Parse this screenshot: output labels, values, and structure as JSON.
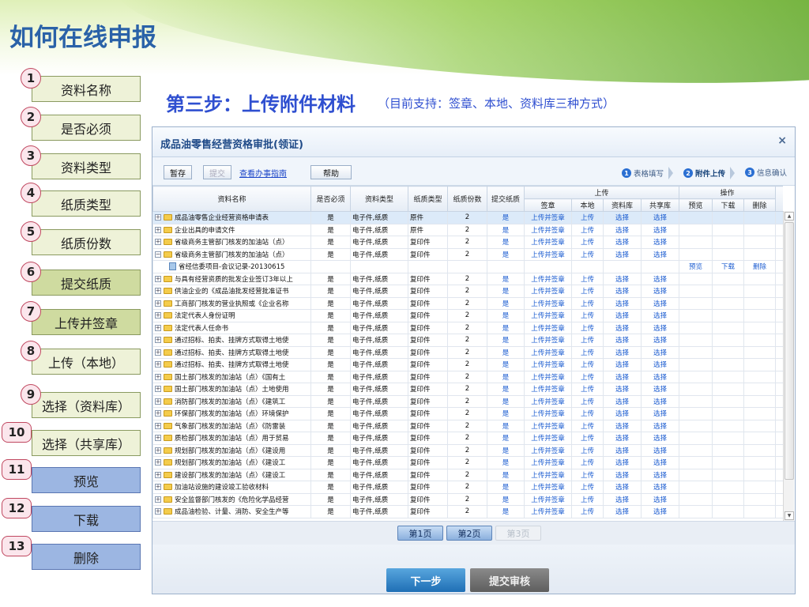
{
  "slide": {
    "title": "如何在线申报",
    "subtitle": "第三步：上传附件材料",
    "subnote": "（目前支持：签章、本地、资料库三种方式）"
  },
  "steps": [
    {
      "num": "1",
      "label": "资料名称"
    },
    {
      "num": "2",
      "label": "是否必须"
    },
    {
      "num": "3",
      "label": "资料类型"
    },
    {
      "num": "4",
      "label": "纸质类型"
    },
    {
      "num": "5",
      "label": "纸质份数"
    },
    {
      "num": "6",
      "label": "提交纸质"
    },
    {
      "num": "7",
      "label": "上传并签章"
    },
    {
      "num": "8",
      "label": "上传（本地）"
    },
    {
      "num": "9",
      "label": "选择（资料库）"
    },
    {
      "num": "10",
      "label": "选择（共享库）"
    },
    {
      "num": "11",
      "label": "预览"
    },
    {
      "num": "12",
      "label": "下载"
    },
    {
      "num": "13",
      "label": "删除"
    }
  ],
  "window": {
    "title": "成品油零售经营资格审批(领证)",
    "close_icon": "×"
  },
  "toolbar": {
    "save": "暂存",
    "submit": "提交",
    "guide": "查看办事指南",
    "help": "帮助"
  },
  "wizard": [
    {
      "num": "1",
      "label": "表格填写"
    },
    {
      "num": "2",
      "label": "附件上传"
    },
    {
      "num": "3",
      "label": "信息确认"
    }
  ],
  "table": {
    "headers": {
      "name": "资料名称",
      "required": "是否必须",
      "type": "资料类型",
      "paper_type": "纸质类型",
      "paper_count": "纸质份数",
      "submit_paper": "提交纸质",
      "upload_group": "上传",
      "sign": "签章",
      "local": "本地",
      "library": "资料库",
      "shared": "共享库",
      "ops_group": "操作",
      "preview": "预览",
      "download": "下载",
      "delete": "删除"
    },
    "rows": [
      {
        "name": "成品油零售企业经营资格申请表",
        "required": "是",
        "type": "电子件,纸质",
        "paper_type": "原件",
        "count": "2",
        "submit": "是",
        "sign": "上传并签章",
        "local": "上传",
        "library": "选择",
        "shared": "选择"
      },
      {
        "name": "企业出具的申请文件",
        "required": "是",
        "type": "电子件,纸质",
        "paper_type": "原件",
        "count": "2",
        "submit": "是",
        "sign": "上传并签章",
        "local": "上传",
        "library": "选择",
        "shared": "选择"
      },
      {
        "name": "省级商务主管部门核发的加油站（点）",
        "required": "是",
        "type": "电子件,纸质",
        "paper_type": "复印件",
        "count": "2",
        "submit": "是",
        "sign": "上传并签章",
        "local": "上传",
        "library": "选择",
        "shared": "选择"
      },
      {
        "name": "省级商务主管部门核发的加油站（点）",
        "required": "是",
        "type": "电子件,纸质",
        "paper_type": "复印件",
        "count": "2",
        "submit": "是",
        "sign": "上传并签章",
        "local": "上传",
        "library": "选择",
        "shared": "选择",
        "expanded": true
      },
      {
        "name": "省经信委项目-会议记录-20130615",
        "sub": true,
        "preview": "预览",
        "download": "下载",
        "delete": "删除"
      },
      {
        "name": "与具有经营资质的批发企业签订3年以上",
        "required": "是",
        "type": "电子件,纸质",
        "paper_type": "复印件",
        "count": "2",
        "submit": "是",
        "sign": "上传并签章",
        "local": "上传",
        "library": "选择",
        "shared": "选择"
      },
      {
        "name": "供油企业的《成品油批发经营批准证书",
        "required": "是",
        "type": "电子件,纸质",
        "paper_type": "复印件",
        "count": "2",
        "submit": "是",
        "sign": "上传并签章",
        "local": "上传",
        "library": "选择",
        "shared": "选择"
      },
      {
        "name": "工商部门核发的营业执照或《企业名称",
        "required": "是",
        "type": "电子件,纸质",
        "paper_type": "复印件",
        "count": "2",
        "submit": "是",
        "sign": "上传并签章",
        "local": "上传",
        "library": "选择",
        "shared": "选择"
      },
      {
        "name": "法定代表人身份证明",
        "required": "是",
        "type": "电子件,纸质",
        "paper_type": "复印件",
        "count": "2",
        "submit": "是",
        "sign": "上传并签章",
        "local": "上传",
        "library": "选择",
        "shared": "选择"
      },
      {
        "name": "法定代表人任命书",
        "required": "是",
        "type": "电子件,纸质",
        "paper_type": "复印件",
        "count": "2",
        "submit": "是",
        "sign": "上传并签章",
        "local": "上传",
        "library": "选择",
        "shared": "选择"
      },
      {
        "name": "通过招标、拍卖、挂牌方式取得土地使",
        "required": "是",
        "type": "电子件,纸质",
        "paper_type": "复印件",
        "count": "2",
        "submit": "是",
        "sign": "上传并签章",
        "local": "上传",
        "library": "选择",
        "shared": "选择"
      },
      {
        "name": "通过招标、拍卖、挂牌方式取得土地使",
        "required": "是",
        "type": "电子件,纸质",
        "paper_type": "复印件",
        "count": "2",
        "submit": "是",
        "sign": "上传并签章",
        "local": "上传",
        "library": "选择",
        "shared": "选择"
      },
      {
        "name": "通过招标、拍卖、挂牌方式取得土地使",
        "required": "是",
        "type": "电子件,纸质",
        "paper_type": "复印件",
        "count": "2",
        "submit": "是",
        "sign": "上传并签章",
        "local": "上传",
        "library": "选择",
        "shared": "选择"
      },
      {
        "name": "国土部门核发的加油站（点）《国有土",
        "required": "是",
        "type": "电子件,纸质",
        "paper_type": "复印件",
        "count": "2",
        "submit": "是",
        "sign": "上传并签章",
        "local": "上传",
        "library": "选择",
        "shared": "选择"
      },
      {
        "name": "国土部门核发的加油站（点）土地使用",
        "required": "是",
        "type": "电子件,纸质",
        "paper_type": "复印件",
        "count": "2",
        "submit": "是",
        "sign": "上传并签章",
        "local": "上传",
        "library": "选择",
        "shared": "选择"
      },
      {
        "name": "消防部门核发的加油站（点）《建筑工",
        "required": "是",
        "type": "电子件,纸质",
        "paper_type": "复印件",
        "count": "2",
        "submit": "是",
        "sign": "上传并签章",
        "local": "上传",
        "library": "选择",
        "shared": "选择"
      },
      {
        "name": "环保部门核发的加油站（点）环境保护",
        "required": "是",
        "type": "电子件,纸质",
        "paper_type": "复印件",
        "count": "2",
        "submit": "是",
        "sign": "上传并签章",
        "local": "上传",
        "library": "选择",
        "shared": "选择"
      },
      {
        "name": "气象部门核发的加油站（点）《防雷装",
        "required": "是",
        "type": "电子件,纸质",
        "paper_type": "复印件",
        "count": "2",
        "submit": "是",
        "sign": "上传并签章",
        "local": "上传",
        "library": "选择",
        "shared": "选择"
      },
      {
        "name": "质检部门核发的加油站（点）用于贸易",
        "required": "是",
        "type": "电子件,纸质",
        "paper_type": "复印件",
        "count": "2",
        "submit": "是",
        "sign": "上传并签章",
        "local": "上传",
        "library": "选择",
        "shared": "选择"
      },
      {
        "name": "规划部门核发的加油站（点）《建设用",
        "required": "是",
        "type": "电子件,纸质",
        "paper_type": "复印件",
        "count": "2",
        "submit": "是",
        "sign": "上传并签章",
        "local": "上传",
        "library": "选择",
        "shared": "选择"
      },
      {
        "name": "规划部门核发的加油站（点）《建设工",
        "required": "是",
        "type": "电子件,纸质",
        "paper_type": "复印件",
        "count": "2",
        "submit": "是",
        "sign": "上传并签章",
        "local": "上传",
        "library": "选择",
        "shared": "选择"
      },
      {
        "name": "建设部门核发的加油站（点）《建设工",
        "required": "是",
        "type": "电子件,纸质",
        "paper_type": "复印件",
        "count": "2",
        "submit": "是",
        "sign": "上传并签章",
        "local": "上传",
        "library": "选择",
        "shared": "选择"
      },
      {
        "name": "加油站设施的建设竣工验收材料",
        "required": "是",
        "type": "电子件,纸质",
        "paper_type": "复印件",
        "count": "2",
        "submit": "是",
        "sign": "上传并签章",
        "local": "上传",
        "library": "选择",
        "shared": "选择"
      },
      {
        "name": "安全监督部门核发的《危险化学品经营",
        "required": "是",
        "type": "电子件,纸质",
        "paper_type": "复印件",
        "count": "2",
        "submit": "是",
        "sign": "上传并签章",
        "local": "上传",
        "library": "选择",
        "shared": "选择"
      },
      {
        "name": "成品油检验、计量、消防、安全生产等",
        "required": "是",
        "type": "电子件,纸质",
        "paper_type": "复印件",
        "count": "2",
        "submit": "是",
        "sign": "上传并签章",
        "local": "上传",
        "library": "选择",
        "shared": "选择"
      }
    ]
  },
  "pager": {
    "page1": "第1页",
    "page2": "第2页",
    "page3": "第3页"
  },
  "footer": {
    "next": "下一步",
    "submit_review": "提交审核"
  }
}
